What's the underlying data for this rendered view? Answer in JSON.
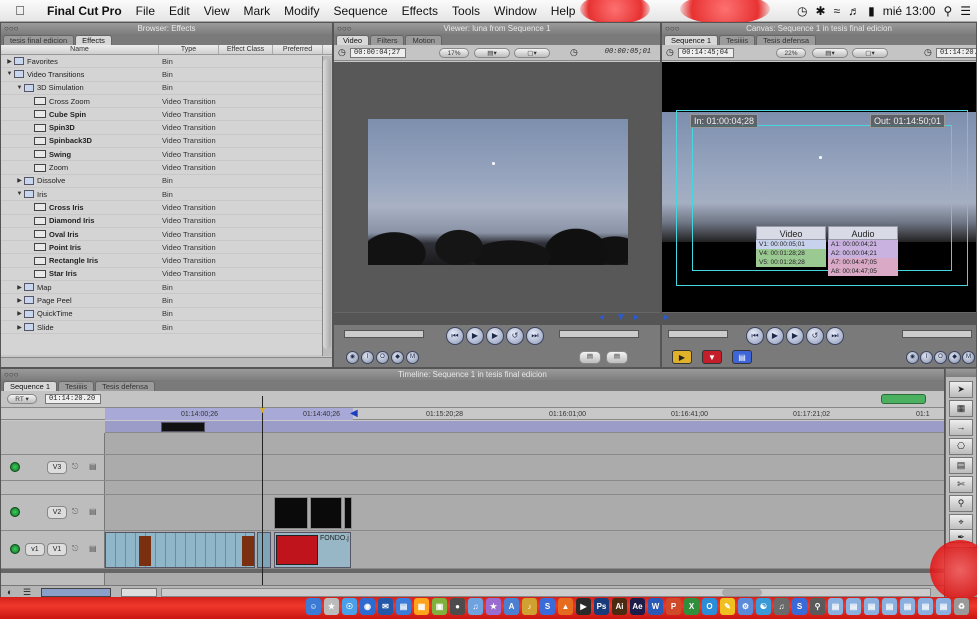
{
  "menubar": {
    "apple_icon": "apple-icon",
    "items": [
      "Final Cut Pro",
      "File",
      "Edit",
      "View",
      "Mark",
      "Modify",
      "Sequence",
      "Effects",
      "Tools",
      "Window",
      "Help"
    ],
    "clock": "mié 13:00"
  },
  "browser": {
    "title": "Browser: Effects",
    "tabs": [
      "tesis final edicion",
      "Effects"
    ],
    "columns": [
      "Name",
      "Type",
      "Effect Class",
      "Preferred"
    ],
    "rows": [
      {
        "name": "Favorites",
        "type": "Bin",
        "kind": "bin",
        "indent": 0,
        "tri": "▶",
        "bold": false
      },
      {
        "name": "Video Transitions",
        "type": "Bin",
        "kind": "bin",
        "indent": 0,
        "tri": "▼",
        "bold": false
      },
      {
        "name": "3D Simulation",
        "type": "Bin",
        "kind": "bin",
        "indent": 1,
        "tri": "▼",
        "bold": false
      },
      {
        "name": "Cross Zoom",
        "type": "Video Transition",
        "kind": "fx",
        "indent": 2,
        "tri": "",
        "bold": false
      },
      {
        "name": "Cube Spin",
        "type": "Video Transition",
        "kind": "fx",
        "indent": 2,
        "tri": "",
        "bold": true
      },
      {
        "name": "Spin3D",
        "type": "Video Transition",
        "kind": "fx",
        "indent": 2,
        "tri": "",
        "bold": true
      },
      {
        "name": "Spinback3D",
        "type": "Video Transition",
        "kind": "fx",
        "indent": 2,
        "tri": "",
        "bold": true
      },
      {
        "name": "Swing",
        "type": "Video Transition",
        "kind": "fx",
        "indent": 2,
        "tri": "",
        "bold": true
      },
      {
        "name": "Zoom",
        "type": "Video Transition",
        "kind": "fx",
        "indent": 2,
        "tri": "",
        "bold": false
      },
      {
        "name": "Dissolve",
        "type": "Bin",
        "kind": "bin",
        "indent": 1,
        "tri": "▶",
        "bold": false
      },
      {
        "name": "Iris",
        "type": "Bin",
        "kind": "bin",
        "indent": 1,
        "tri": "▼",
        "bold": false
      },
      {
        "name": "Cross Iris",
        "type": "Video Transition",
        "kind": "fx",
        "indent": 2,
        "tri": "",
        "bold": true
      },
      {
        "name": "Diamond Iris",
        "type": "Video Transition",
        "kind": "fx",
        "indent": 2,
        "tri": "",
        "bold": true
      },
      {
        "name": "Oval Iris",
        "type": "Video Transition",
        "kind": "fx",
        "indent": 2,
        "tri": "",
        "bold": true
      },
      {
        "name": "Point Iris",
        "type": "Video Transition",
        "kind": "fx",
        "indent": 2,
        "tri": "",
        "bold": true
      },
      {
        "name": "Rectangle Iris",
        "type": "Video Transition",
        "kind": "fx",
        "indent": 2,
        "tri": "",
        "bold": true
      },
      {
        "name": "Star Iris",
        "type": "Video Transition",
        "kind": "fx",
        "indent": 2,
        "tri": "",
        "bold": true
      },
      {
        "name": "Map",
        "type": "Bin",
        "kind": "bin",
        "indent": 1,
        "tri": "▶",
        "bold": false
      },
      {
        "name": "Page Peel",
        "type": "Bin",
        "kind": "bin",
        "indent": 1,
        "tri": "▶",
        "bold": false
      },
      {
        "name": "QuickTime",
        "type": "Bin",
        "kind": "bin",
        "indent": 1,
        "tri": "▶",
        "bold": false
      },
      {
        "name": "Slide",
        "type": "Bin",
        "kind": "bin",
        "indent": 1,
        "tri": "▶",
        "bold": false
      }
    ]
  },
  "viewer": {
    "title": "Viewer: luna from Sequence 1",
    "tabs": [
      "Video",
      "Filters",
      "Motion"
    ],
    "timecode_duration": "00:00:04;27",
    "zoom": "17%",
    "timecode_current": "00:00:05;01"
  },
  "canvas": {
    "title": "Canvas: Sequence 1 in tesis final edicion",
    "tabs": [
      "Sequence 1",
      "Tesiiiis",
      "Tesis defensa"
    ],
    "timecode_duration": "00:14:45;04",
    "zoom": "22%",
    "timecode_current": "01:14:20.2",
    "in_point": "In: 01:00:04;28",
    "out_point": "Out: 01:14:50;01",
    "overlay": {
      "video_header": "Video",
      "audio_header": "Audio",
      "video_rows": [
        "V1: 00:00:05;01",
        "V4: 00:01:28;28",
        "V5: 00:01:28;28"
      ],
      "audio_rows": [
        "A1: 00:00:04;21",
        "A2: 00:00:04;21",
        "A7: 00:04:47;05",
        "A8: 00:04:47;05"
      ]
    }
  },
  "timeline": {
    "title": "Timeline: Sequence 1 in tesis final edicion",
    "tabs": [
      "Sequence 1",
      "Tesiiiis",
      "Tesis defensa"
    ],
    "rt": "RT ▾",
    "current_tc": "01:14:20.20",
    "ticks": [
      "01:14:00;26",
      "01:14:40;26",
      "01:15:20;28",
      "01:16:01;00",
      "01:16:41;00",
      "01:17:21;02",
      "01:1"
    ],
    "tracks": [
      {
        "src": "",
        "dst": "V3"
      },
      {
        "src": "",
        "dst": "V2"
      },
      {
        "src": "v1",
        "dst": "V1"
      }
    ],
    "clip_label": "FONDO.j"
  },
  "colors": {
    "accent": "#46d6e0",
    "record_green": "#2fbf4f",
    "dock_red": "#e3281f"
  }
}
